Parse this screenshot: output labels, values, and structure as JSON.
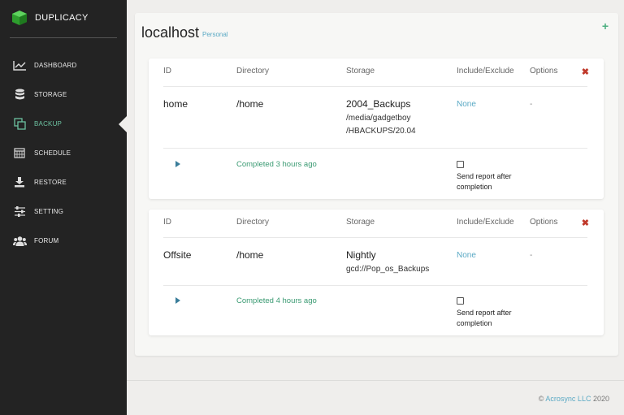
{
  "app": {
    "name": "DUPLICACY"
  },
  "nav": {
    "items": [
      {
        "label": "DASHBOARD",
        "icon": "chart-line-icon"
      },
      {
        "label": "STORAGE",
        "icon": "database-icon"
      },
      {
        "label": "BACKUP",
        "icon": "copy-icon"
      },
      {
        "label": "SCHEDULE",
        "icon": "calendar-icon"
      },
      {
        "label": "RESTORE",
        "icon": "download-icon"
      },
      {
        "label": "SETTING",
        "icon": "sliders-icon"
      },
      {
        "label": "FORUM",
        "icon": "users-icon"
      }
    ],
    "active": "BACKUP"
  },
  "host": {
    "name": "localhost",
    "badge": "Personal",
    "add_label": "+"
  },
  "columns": {
    "id": "ID",
    "directory": "Directory",
    "storage": "Storage",
    "include_exclude": "Include/Exclude",
    "options": "Options"
  },
  "backups": [
    {
      "id": "home",
      "directory": "/home",
      "storage_name": "2004_Backups",
      "storage_path_1": "/media/gadgetboy",
      "storage_path_2": "/HBACKUPS/20.04",
      "include_exclude": "None",
      "options": "-",
      "status": "Completed 3 hours ago",
      "report_label": "Send report after completion"
    },
    {
      "id": "Offsite",
      "directory": "/home",
      "storage_name": "Nightly",
      "storage_path_1": "gcd://Pop_os_Backups",
      "include_exclude": "None",
      "options": "-",
      "status": "Completed 4 hours ago",
      "report_label": "Send report after completion"
    }
  ],
  "footer": {
    "copyright": "©",
    "company": "Acrosync LLC",
    "year": "2020"
  },
  "colors": {
    "sidebar": "#232323",
    "accent": "#6cc1a0",
    "link": "#5aa9c4",
    "delete": "#c0392b"
  }
}
